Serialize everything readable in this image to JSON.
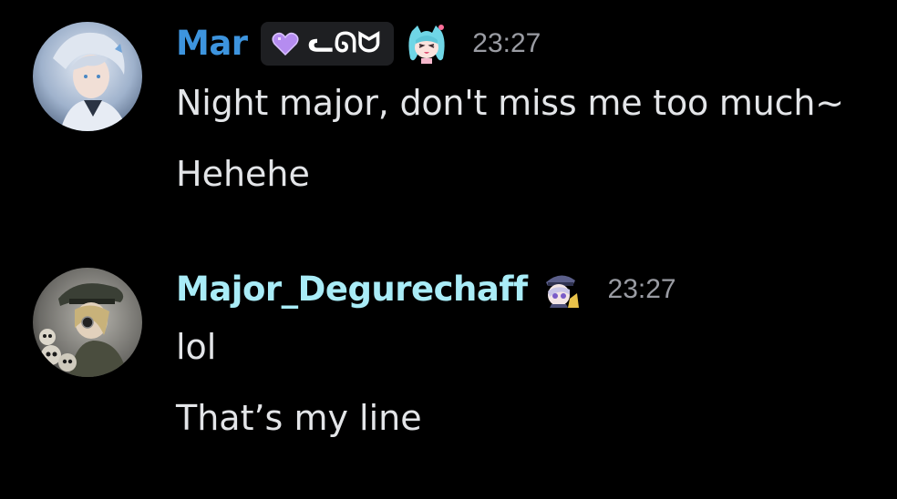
{
  "colors": {
    "background": "#000000",
    "user1_name": "#3d94de",
    "user2_name": "#a9ecf7",
    "timestamp": "#9a9ca3",
    "message_text": "#e3e5e8",
    "clan_tag_bg": "#1e1f22",
    "clan_heart": "#b58cf0"
  },
  "messages": [
    {
      "username": "Mar",
      "avatar_icon": "avatar-silver-haired-character",
      "clan_tag": {
        "icon": "purple-heart-icon",
        "text": "ᓚᘏᗢ"
      },
      "role_icon": "cyan-hair-catgirl-emoji",
      "timestamp": "23:27",
      "lines": [
        "Night major, don't miss me too much~",
        "Hehehe"
      ]
    },
    {
      "username": "Major_Degurechaff",
      "avatar_icon": "avatar-soldier-with-skulls",
      "role_icon": "chibi-officer-emoji",
      "timestamp": "23:27",
      "lines": [
        "lol",
        "That’s my line"
      ]
    }
  ]
}
